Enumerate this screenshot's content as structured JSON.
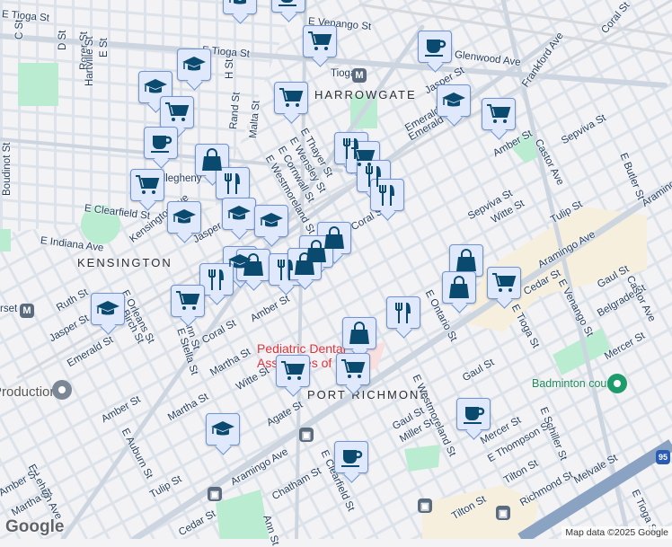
{
  "neighborhoods": [
    "HARROWGATE",
    "KENSINGTON",
    "PORT RICHMOND"
  ],
  "streets": [
    "E Tioga St",
    "E Tioga St",
    "E Venango St",
    "Glenwood Ave",
    "Frankford Ave",
    "Coral St",
    "Castor Ave",
    "E Butler St",
    "Aramingo Ave",
    "Aramingo Ave",
    "Jasper St",
    "Emerald St",
    "Amber St",
    "Sepviva St",
    "Witte St",
    "Tulip St",
    "C St",
    "D St",
    "Rorer St",
    "Hartville St",
    "E St",
    "H St",
    "Rand St",
    "Malta St",
    "E Thayer St",
    "E Wensley St",
    "E Cornwall St",
    "E Westmoreland St",
    "Boudinot St",
    "E Clearfield St",
    "E Indiana Ave",
    "Kensington Ave",
    "Jasper St",
    "Ruth St",
    "E Orleans St",
    "Birch St",
    "Jasper St",
    "Emerald St",
    "Coral St",
    "Amber St",
    "Ann St",
    "E Stella St",
    "Martha St",
    "Martha St",
    "Witte St",
    "Amber St",
    "E Auburn St",
    "Agate St",
    "E Lehigh Ave",
    "Amber St",
    "Martha St",
    "Tulip St",
    "Aramingo Ave",
    "Chatham St",
    "Cedar St",
    "Ann St",
    "E Westmoreland St",
    "Gaul St",
    "Gaul St",
    "Miller St",
    "Mercer St",
    "E Thompson St",
    "E Schiller St",
    "Tilton St",
    "Tilton St",
    "Richmond St",
    "Melvale St",
    "E Tioga St",
    "Mercer St",
    "Belgrade St",
    "Gaul St",
    "E Venango St",
    "Cedar St",
    "E Ontario St",
    "E Tioga St",
    "Castor Ave",
    "E Clearfield St",
    "Sepviva St",
    "Emerald St",
    "Coral St"
  ],
  "stations": {
    "tioga": "Tioga",
    "allegheny": "Allegheny",
    "somerset": "Somerset",
    "metro_icon": "M"
  },
  "pois": {
    "dental": "Pediatric Dental Associates of",
    "badminton": "Badminton court",
    "productions": "Productions"
  },
  "highway_shield": "95",
  "attribution": "Map data ©2025 Google",
  "logo": "Google",
  "marker_color": "#0b4a6f",
  "park_color": "#b9ecd0"
}
